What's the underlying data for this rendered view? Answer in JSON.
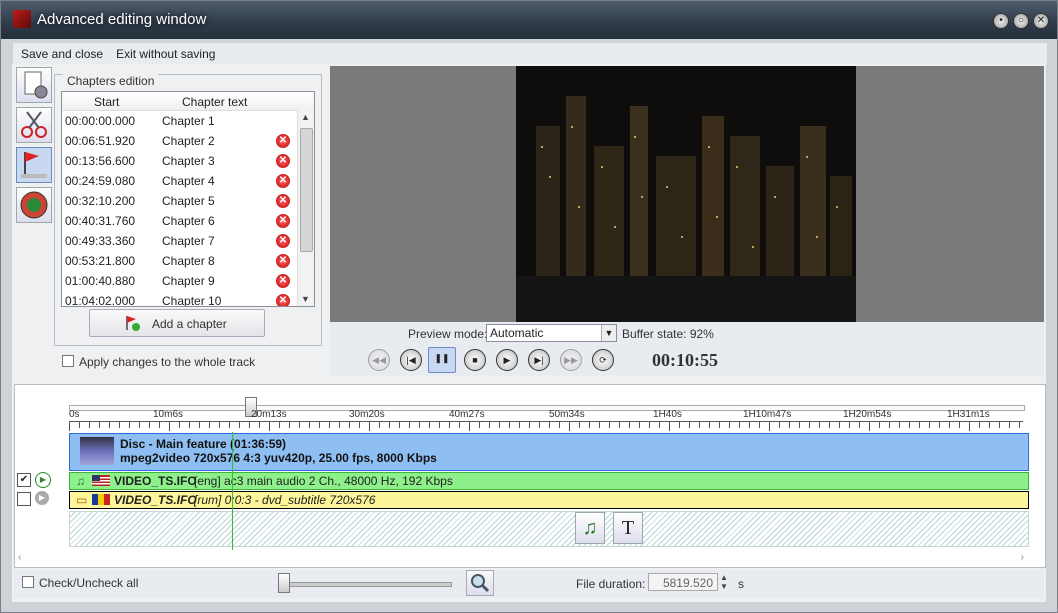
{
  "window": {
    "title": "Advanced editing window"
  },
  "menu": {
    "save_close": "Save and close",
    "exit_nosave": "Exit without saving"
  },
  "chapters": {
    "legend": "Chapters edition",
    "col_start": "Start",
    "col_text": "Chapter text",
    "rows": [
      {
        "start": "00:00:00.000",
        "text": "Chapter 1"
      },
      {
        "start": "00:06:51.920",
        "text": "Chapter 2"
      },
      {
        "start": "00:13:56.600",
        "text": "Chapter 3"
      },
      {
        "start": "00:24:59.080",
        "text": "Chapter 4"
      },
      {
        "start": "00:32:10.200",
        "text": "Chapter 5"
      },
      {
        "start": "00:40:31.760",
        "text": "Chapter 6"
      },
      {
        "start": "00:49:33.360",
        "text": "Chapter 7"
      },
      {
        "start": "00:53:21.800",
        "text": "Chapter 8"
      },
      {
        "start": "01:00:40.880",
        "text": "Chapter 9"
      },
      {
        "start": "01:04:02.000",
        "text": "Chapter 10"
      }
    ],
    "add_label": "Add a chapter",
    "apply_label": "Apply changes to the whole track"
  },
  "preview": {
    "mode_label": "Preview mode:",
    "mode_value": "Automatic",
    "buffer_label": "Buffer state: 92%",
    "timecode": "00:10:55"
  },
  "timeline": {
    "ticks": [
      "0s",
      "10m6s",
      "20m13s",
      "30m20s",
      "40m27s",
      "50m34s",
      "1H40s",
      "1H10m47s",
      "1H20m54s",
      "1H31m1s"
    ],
    "video_line1": "Disc - Main feature (01:36:59)",
    "video_line2": "mpeg2video 720x576 4:3 yuv420p, 25.00 fps, 8000 Kbps",
    "audio_file": "VIDEO_TS.IFO",
    "audio_desc": "[eng] ac3 main audio 2 Ch., 48000 Hz, 192 Kbps",
    "sub_file": "VIDEO_TS.IFO",
    "sub_desc": "[rum] 0:0:3 - dvd_subtitle 720x576"
  },
  "bottom": {
    "check_all": "Check/Uncheck all",
    "file_duration_label": "File duration:",
    "file_duration_value": "5819.520",
    "unit": "s"
  }
}
